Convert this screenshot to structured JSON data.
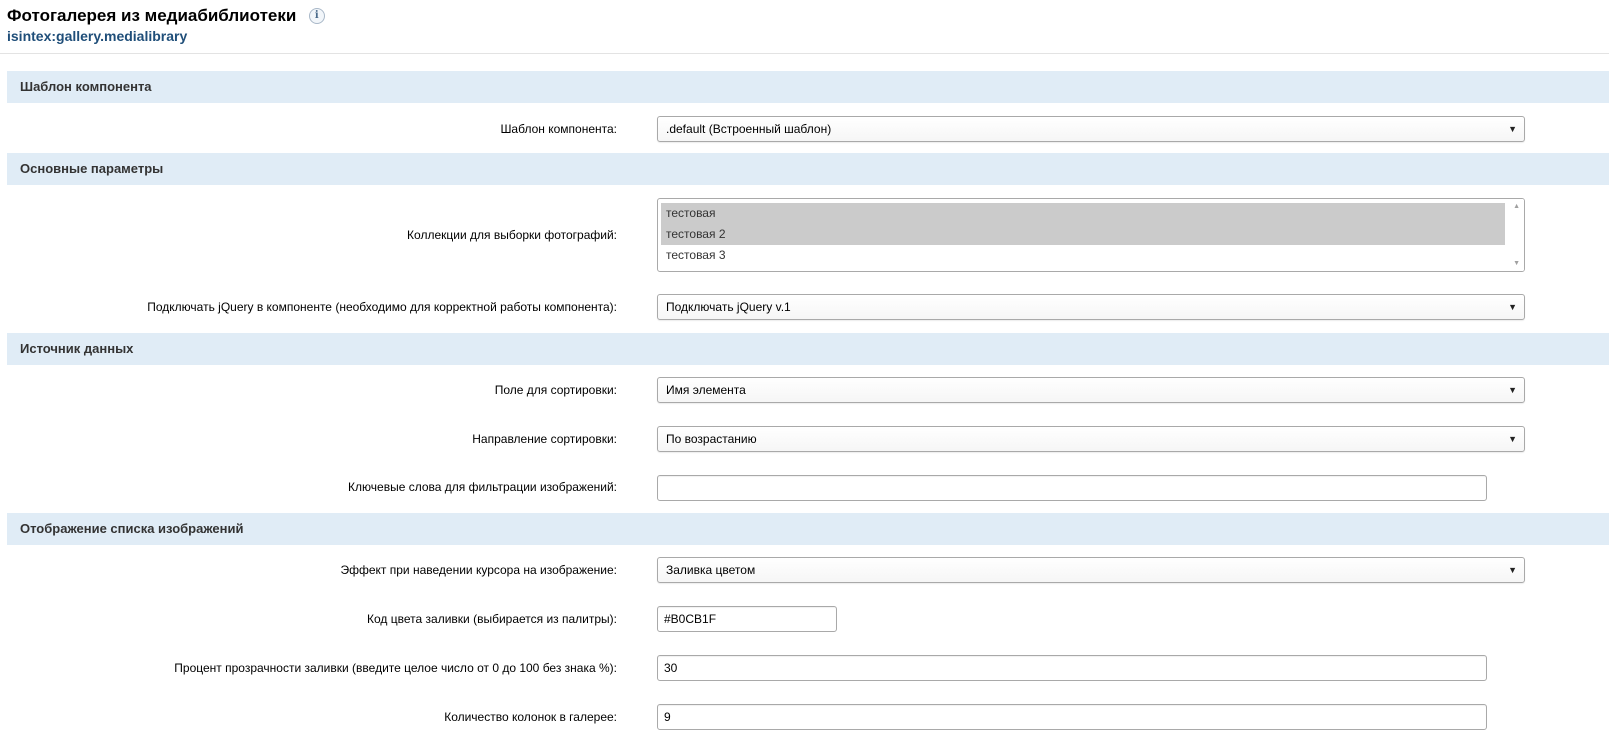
{
  "header": {
    "title": "Фотогалерея из медиабиблиотеки",
    "info_icon": "i",
    "component_id": "isintex:gallery.medialibrary"
  },
  "sections": {
    "template": "Шаблон компонента",
    "main": "Основные параметры",
    "data_source": "Источник данных",
    "list_display": "Отображение списка изображений"
  },
  "fields": {
    "template": {
      "label": "Шаблон компонента:",
      "value": ".default (Встроенный шаблон)"
    },
    "collections": {
      "label": "Коллекции для выборки фотографий:",
      "options": [
        "тестовая",
        "тестовая 2",
        "тестовая 3"
      ],
      "selected": [
        true,
        true,
        false
      ]
    },
    "jquery": {
      "label": "Подключать jQuery в компоненте (необходимо для корректной работы компонента):",
      "value": "Подключать jQuery v.1"
    },
    "sort_field": {
      "label": "Поле для сортировки:",
      "value": "Имя элемента"
    },
    "sort_direction": {
      "label": "Направление сортировки:",
      "value": "По возрастанию"
    },
    "keywords": {
      "label": "Ключевые слова для фильтрации изображений:",
      "value": ""
    },
    "hover_effect": {
      "label": "Эффект при наведении курсора на изображение:",
      "value": "Заливка цветом"
    },
    "fill_color": {
      "label": "Код цвета заливки (выбирается из палитры):",
      "value": "#B0CB1F"
    },
    "fill_opacity": {
      "label": "Процент прозрачности заливки (введите целое число от 0 до 100 без знака %):",
      "value": "30"
    },
    "columns": {
      "label": "Количество колонок в галерее:",
      "value": "9"
    }
  },
  "icons": {
    "dropdown_arrow": "▼",
    "scroll_up": "▲",
    "scroll_down": "▼"
  },
  "colors": {
    "section_bg": "#e0ecf6",
    "subtitle": "#1f4e79",
    "selected_option": "#cbcbcb"
  }
}
